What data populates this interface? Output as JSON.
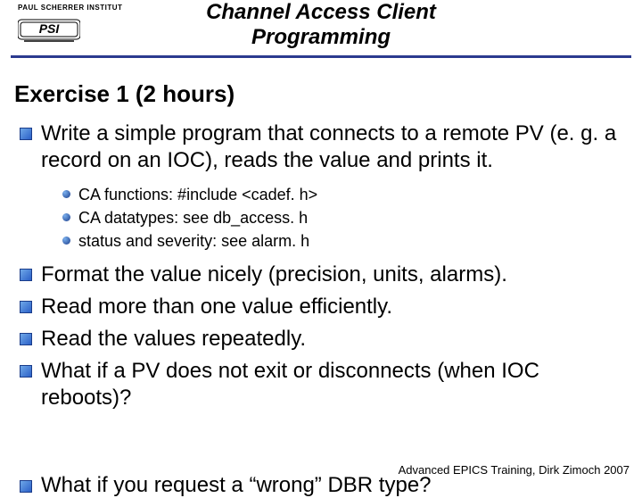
{
  "header": {
    "institute": "PAUL SCHERRER INSTITUT",
    "title_line1": "Channel Access Client",
    "title_line2": "Programming"
  },
  "section_heading": "Exercise 1 (2 hours)",
  "bullets": [
    {
      "text": "Write a simple program that connects to a remote PV (e. g. a record on an IOC), reads the value and prints it.",
      "sub": [
        "CA functions: #include <cadef. h>",
        "CA datatypes: see db_access. h",
        "status and severity: see alarm. h"
      ]
    },
    {
      "text": "Format the value nicely (precision, units, alarms)."
    },
    {
      "text": "Read more than one value efficiently."
    },
    {
      "text": "Read the values repeatedly."
    },
    {
      "text": "What if a PV does not exit or disconnects (when IOC reboots)?"
    }
  ],
  "cutoff_text": "What if you request a “wrong” DBR type?",
  "footer": "Advanced EPICS Training, Dirk Zimoch 2007"
}
